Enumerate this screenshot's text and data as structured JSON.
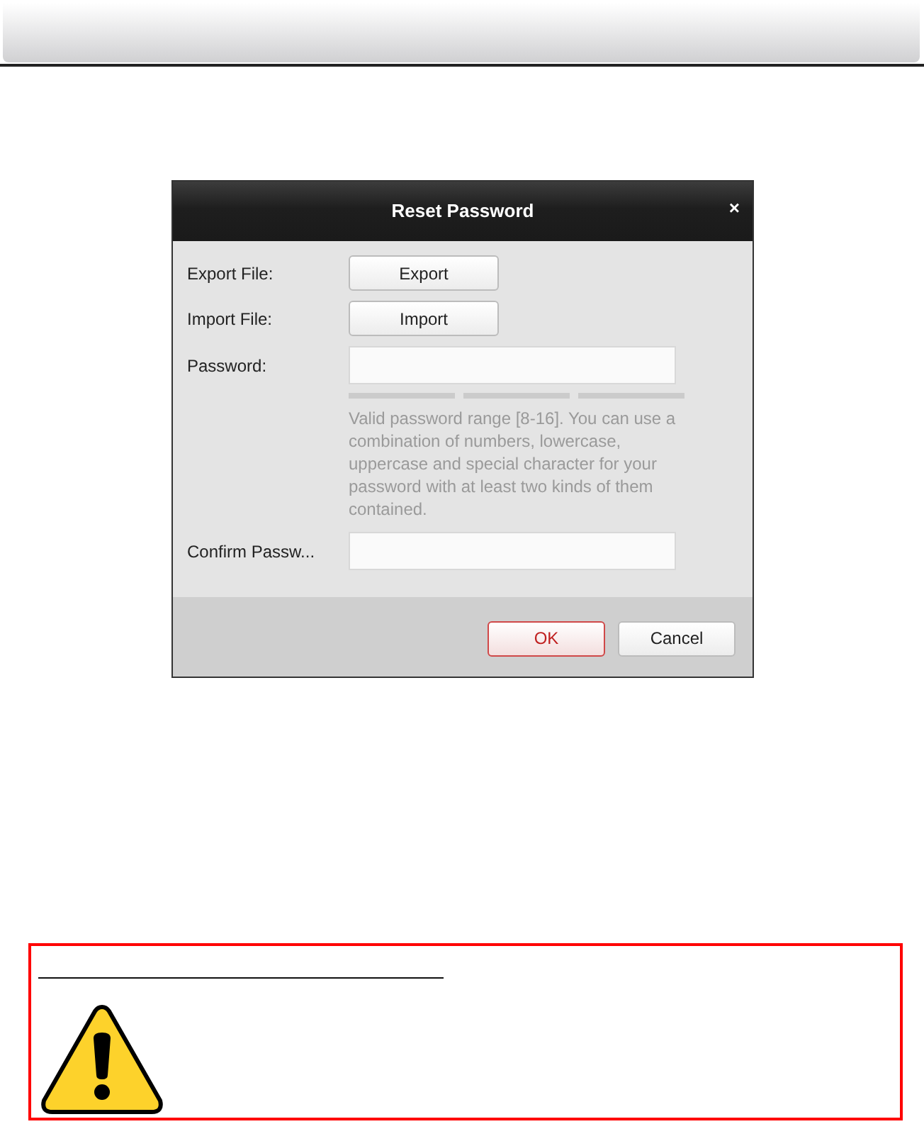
{
  "dialog": {
    "title": "Reset Password",
    "close": "×",
    "rows": [
      {
        "kind": "button",
        "label": "Export File:",
        "button": "Export"
      },
      {
        "kind": "button",
        "label": "Import File:",
        "button": "Import"
      },
      {
        "kind": "password",
        "label": "Password:"
      },
      {
        "kind": "hint",
        "text": "Valid password range [8-16]. You can use a combination of numbers, lowercase, uppercase and special character for your password with at least two kinds of them contained."
      },
      {
        "kind": "input",
        "label": "Confirm Passw..."
      }
    ],
    "buttons": [
      {
        "label": "OK",
        "default": true
      },
      {
        "label": "Cancel",
        "default": false
      }
    ]
  },
  "warning_box": {
    "kind": "caution"
  }
}
